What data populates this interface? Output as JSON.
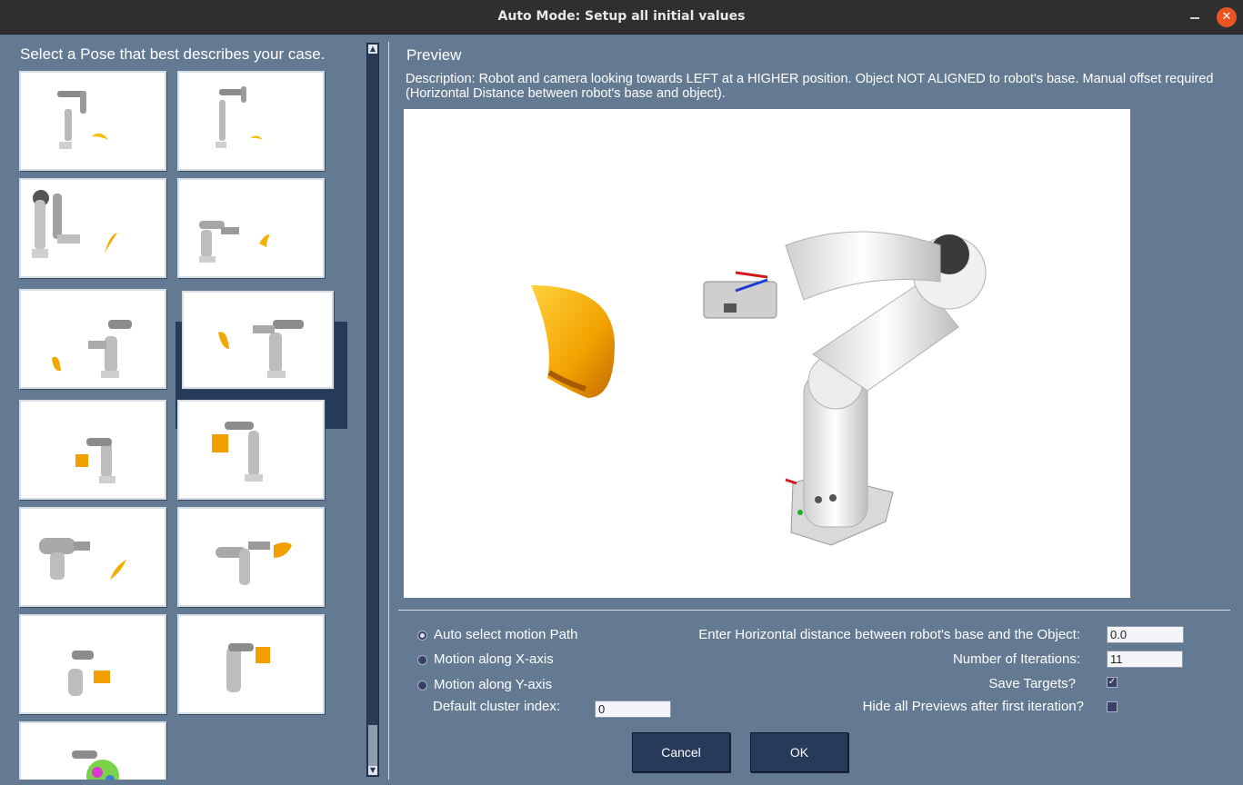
{
  "window": {
    "title": "Auto Mode: Setup all initial values",
    "close_glyph": "✕"
  },
  "left": {
    "heading": "Select a Pose that best describes your case.",
    "selected_index": 5,
    "thumbnail_count": 11
  },
  "preview": {
    "heading": "Preview",
    "description": "Description: Robot and camera looking towards LEFT at a HIGHER position. Object NOT ALIGNED to robot's base. Manual offset required (Horizontal Distance between robot's base and object)."
  },
  "options": {
    "motion": [
      {
        "label": "Auto select motion Path",
        "selected": true
      },
      {
        "label": "Motion along X-axis",
        "selected": false
      },
      {
        "label": "Motion along Y-axis",
        "selected": false
      }
    ],
    "cluster_label": "Default cluster index:",
    "cluster_value": "0",
    "distance_label": "Enter Horizontal distance between robot's base and the Object:",
    "distance_value": "0.0",
    "iterations_label": "Number of Iterations:",
    "iterations_value": "11",
    "save_targets_label": "Save Targets?",
    "save_targets_checked": true,
    "hide_previews_label": "Hide all Previews after first iteration?",
    "hide_previews_checked": false
  },
  "buttons": {
    "cancel": "Cancel",
    "ok": "OK"
  },
  "colors": {
    "panel_bg": "#647a93",
    "button_bg": "#263a59",
    "close_button": "#e95420",
    "object": "#f5b000"
  },
  "icons": [
    "minimize-icon",
    "close-icon",
    "scroll-up-icon",
    "scroll-down-icon",
    "checkmark-icon",
    "robot-arm-icon"
  ]
}
